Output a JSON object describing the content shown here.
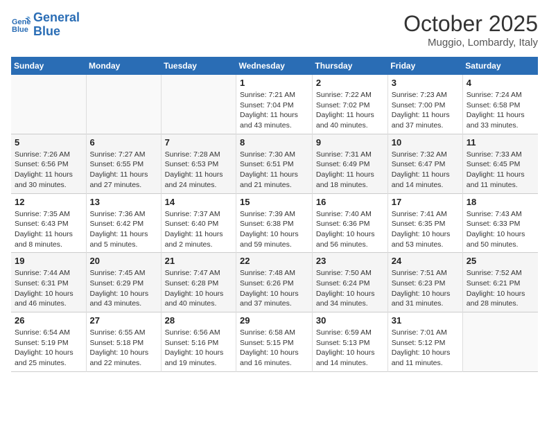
{
  "header": {
    "logo_line1": "General",
    "logo_line2": "Blue",
    "month": "October 2025",
    "location": "Muggio, Lombardy, Italy"
  },
  "weekdays": [
    "Sunday",
    "Monday",
    "Tuesday",
    "Wednesday",
    "Thursday",
    "Friday",
    "Saturday"
  ],
  "weeks": [
    [
      {
        "day": "",
        "info": ""
      },
      {
        "day": "",
        "info": ""
      },
      {
        "day": "",
        "info": ""
      },
      {
        "day": "1",
        "info": "Sunrise: 7:21 AM\nSunset: 7:04 PM\nDaylight: 11 hours and 43 minutes."
      },
      {
        "day": "2",
        "info": "Sunrise: 7:22 AM\nSunset: 7:02 PM\nDaylight: 11 hours and 40 minutes."
      },
      {
        "day": "3",
        "info": "Sunrise: 7:23 AM\nSunset: 7:00 PM\nDaylight: 11 hours and 37 minutes."
      },
      {
        "day": "4",
        "info": "Sunrise: 7:24 AM\nSunset: 6:58 PM\nDaylight: 11 hours and 33 minutes."
      }
    ],
    [
      {
        "day": "5",
        "info": "Sunrise: 7:26 AM\nSunset: 6:56 PM\nDaylight: 11 hours and 30 minutes."
      },
      {
        "day": "6",
        "info": "Sunrise: 7:27 AM\nSunset: 6:55 PM\nDaylight: 11 hours and 27 minutes."
      },
      {
        "day": "7",
        "info": "Sunrise: 7:28 AM\nSunset: 6:53 PM\nDaylight: 11 hours and 24 minutes."
      },
      {
        "day": "8",
        "info": "Sunrise: 7:30 AM\nSunset: 6:51 PM\nDaylight: 11 hours and 21 minutes."
      },
      {
        "day": "9",
        "info": "Sunrise: 7:31 AM\nSunset: 6:49 PM\nDaylight: 11 hours and 18 minutes."
      },
      {
        "day": "10",
        "info": "Sunrise: 7:32 AM\nSunset: 6:47 PM\nDaylight: 11 hours and 14 minutes."
      },
      {
        "day": "11",
        "info": "Sunrise: 7:33 AM\nSunset: 6:45 PM\nDaylight: 11 hours and 11 minutes."
      }
    ],
    [
      {
        "day": "12",
        "info": "Sunrise: 7:35 AM\nSunset: 6:43 PM\nDaylight: 11 hours and 8 minutes."
      },
      {
        "day": "13",
        "info": "Sunrise: 7:36 AM\nSunset: 6:42 PM\nDaylight: 11 hours and 5 minutes."
      },
      {
        "day": "14",
        "info": "Sunrise: 7:37 AM\nSunset: 6:40 PM\nDaylight: 11 hours and 2 minutes."
      },
      {
        "day": "15",
        "info": "Sunrise: 7:39 AM\nSunset: 6:38 PM\nDaylight: 10 hours and 59 minutes."
      },
      {
        "day": "16",
        "info": "Sunrise: 7:40 AM\nSunset: 6:36 PM\nDaylight: 10 hours and 56 minutes."
      },
      {
        "day": "17",
        "info": "Sunrise: 7:41 AM\nSunset: 6:35 PM\nDaylight: 10 hours and 53 minutes."
      },
      {
        "day": "18",
        "info": "Sunrise: 7:43 AM\nSunset: 6:33 PM\nDaylight: 10 hours and 50 minutes."
      }
    ],
    [
      {
        "day": "19",
        "info": "Sunrise: 7:44 AM\nSunset: 6:31 PM\nDaylight: 10 hours and 46 minutes."
      },
      {
        "day": "20",
        "info": "Sunrise: 7:45 AM\nSunset: 6:29 PM\nDaylight: 10 hours and 43 minutes."
      },
      {
        "day": "21",
        "info": "Sunrise: 7:47 AM\nSunset: 6:28 PM\nDaylight: 10 hours and 40 minutes."
      },
      {
        "day": "22",
        "info": "Sunrise: 7:48 AM\nSunset: 6:26 PM\nDaylight: 10 hours and 37 minutes."
      },
      {
        "day": "23",
        "info": "Sunrise: 7:50 AM\nSunset: 6:24 PM\nDaylight: 10 hours and 34 minutes."
      },
      {
        "day": "24",
        "info": "Sunrise: 7:51 AM\nSunset: 6:23 PM\nDaylight: 10 hours and 31 minutes."
      },
      {
        "day": "25",
        "info": "Sunrise: 7:52 AM\nSunset: 6:21 PM\nDaylight: 10 hours and 28 minutes."
      }
    ],
    [
      {
        "day": "26",
        "info": "Sunrise: 6:54 AM\nSunset: 5:19 PM\nDaylight: 10 hours and 25 minutes."
      },
      {
        "day": "27",
        "info": "Sunrise: 6:55 AM\nSunset: 5:18 PM\nDaylight: 10 hours and 22 minutes."
      },
      {
        "day": "28",
        "info": "Sunrise: 6:56 AM\nSunset: 5:16 PM\nDaylight: 10 hours and 19 minutes."
      },
      {
        "day": "29",
        "info": "Sunrise: 6:58 AM\nSunset: 5:15 PM\nDaylight: 10 hours and 16 minutes."
      },
      {
        "day": "30",
        "info": "Sunrise: 6:59 AM\nSunset: 5:13 PM\nDaylight: 10 hours and 14 minutes."
      },
      {
        "day": "31",
        "info": "Sunrise: 7:01 AM\nSunset: 5:12 PM\nDaylight: 10 hours and 11 minutes."
      },
      {
        "day": "",
        "info": ""
      }
    ]
  ]
}
